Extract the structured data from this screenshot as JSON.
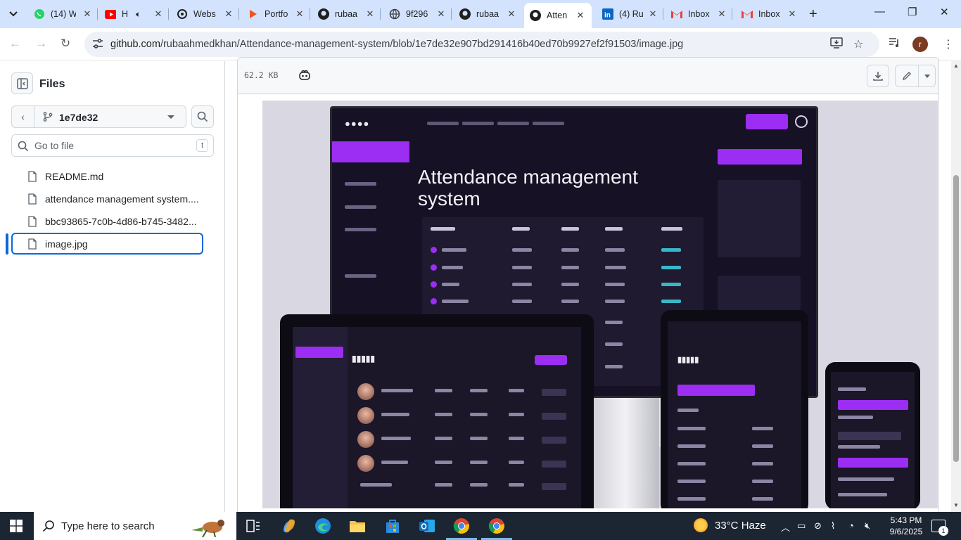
{
  "browser": {
    "tabs": [
      {
        "title": "(14) W",
        "icon": "whatsapp-icon"
      },
      {
        "title": "H",
        "icon": "youtube-icon"
      },
      {
        "title": "Webs",
        "icon": "openai-icon"
      },
      {
        "title": "Portfo",
        "icon": "portfolio-icon"
      },
      {
        "title": "rubaa",
        "icon": "github-icon"
      },
      {
        "title": "9f296",
        "icon": "globe-icon"
      },
      {
        "title": "rubaa",
        "icon": "github-icon"
      },
      {
        "title": "Atten",
        "icon": "github-icon",
        "active": true
      },
      {
        "title": "(4) Ru",
        "icon": "linkedin-icon"
      },
      {
        "title": "Inbox",
        "icon": "gmail-icon"
      },
      {
        "title": "Inbox",
        "icon": "gmail-icon"
      }
    ],
    "url_host": "github.com",
    "url_path": "/rubaahmedkhan/Attendance-management-system/blob/1e7de32e907bd291416b40ed70b9927ef2f91503/image.jpg",
    "profile_initial": "r"
  },
  "sidebar": {
    "title": "Files",
    "branch": "1e7de32",
    "goto_placeholder": "Go to file",
    "goto_shortcut": "t",
    "files": [
      {
        "name": "README.md"
      },
      {
        "name": "attendance management system...."
      },
      {
        "name": "bbc93865-7c0b-4d86-b745-3482..."
      },
      {
        "name": "image.jpg",
        "selected": true
      }
    ]
  },
  "blob": {
    "size": "62.2 KB"
  },
  "image_content": {
    "headline": "Attendance management system"
  },
  "taskbar": {
    "search_placeholder": "Type here to search",
    "weather_temp": "33°C",
    "weather_desc": "Haze",
    "time": "5:43 PM",
    "date": "9/6/2025",
    "notification_count": "1"
  },
  "colors": {
    "accent": "#0969da",
    "tabstrip": "#d3e3fd",
    "purple": "#9b2ef2",
    "taskbar": "#1c2532"
  }
}
